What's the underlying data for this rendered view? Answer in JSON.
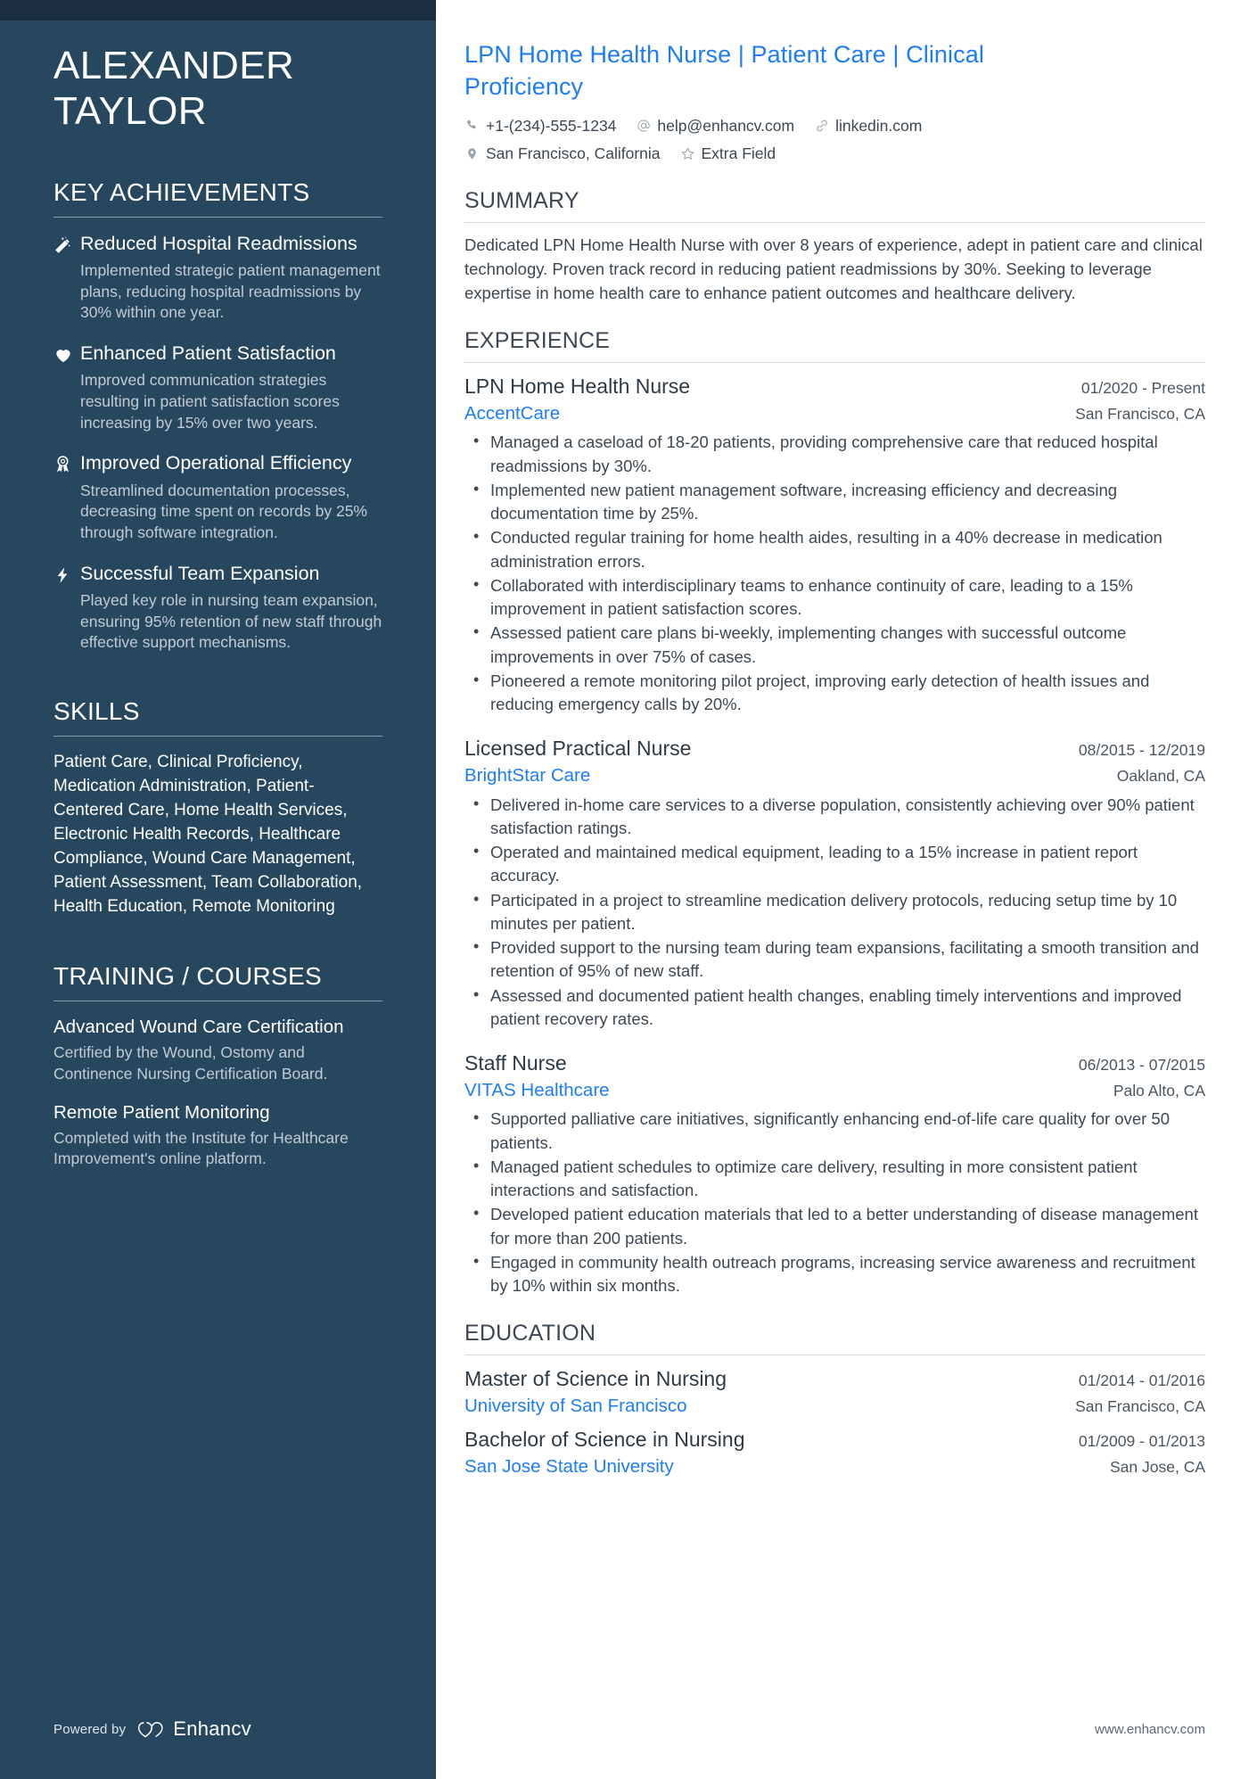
{
  "sidebar": {
    "name_first": "ALEXANDER",
    "name_last": "TAYLOR",
    "achievements_heading": "KEY ACHIEVEMENTS",
    "achievements": [
      {
        "icon": "magic-wand-icon",
        "title": "Reduced Hospital Readmissions",
        "desc": "Implemented strategic patient management plans, reducing hospital readmissions by 30% within one year."
      },
      {
        "icon": "heart-icon",
        "title": "Enhanced Patient Satisfaction",
        "desc": "Improved communication strategies resulting in patient satisfaction scores increasing by 15% over two years."
      },
      {
        "icon": "award-ribbon-icon",
        "title": "Improved Operational Efficiency",
        "desc": "Streamlined documentation processes, decreasing time spent on records by 25% through software integration."
      },
      {
        "icon": "lightning-bolt-icon",
        "title": "Successful Team Expansion",
        "desc": "Played key role in nursing team expansion, ensuring 95% retention of new staff through effective support mechanisms."
      }
    ],
    "skills_heading": "SKILLS",
    "skills_text": "Patient Care, Clinical Proficiency, Medication Administration, Patient-Centered Care, Home Health Services, Electronic Health Records, Healthcare Compliance, Wound Care Management, Patient Assessment, Team Collaboration, Health Education, Remote Monitoring",
    "training_heading": "TRAINING / COURSES",
    "courses": [
      {
        "title": "Advanced Wound Care Certification",
        "desc": "Certified by the Wound, Ostomy and Continence Nursing Certification Board."
      },
      {
        "title": "Remote Patient Monitoring",
        "desc": "Completed with the Institute for Healthcare Improvement's online platform."
      }
    ],
    "footer": {
      "powered_by": "Powered by",
      "brand": "Enhancv"
    }
  },
  "main": {
    "headline": "LPN Home Health Nurse | Patient Care | Clinical Proficiency",
    "contacts": [
      {
        "icon": "phone-icon",
        "text": "+1-(234)-555-1234"
      },
      {
        "icon": "at-email-icon",
        "text": "help@enhancv.com"
      },
      {
        "icon": "link-icon",
        "text": "linkedin.com"
      },
      {
        "icon": "location-pin-icon",
        "text": "San Francisco, California"
      },
      {
        "icon": "star-icon",
        "text": "Extra Field"
      }
    ],
    "summary_heading": "SUMMARY",
    "summary_text": "Dedicated LPN Home Health Nurse with over 8 years of experience, adept in patient care and clinical technology. Proven track record in reducing patient readmissions by 30%. Seeking to leverage expertise in home health care to enhance patient outcomes and healthcare delivery.",
    "experience_heading": "EXPERIENCE",
    "experience": [
      {
        "title": "LPN Home Health Nurse",
        "dates": "01/2020 - Present",
        "org": "AccentCare",
        "location": "San Francisco, CA",
        "bullets": [
          "Managed a caseload of 18-20 patients, providing comprehensive care that reduced hospital readmissions by 30%.",
          "Implemented new patient management software, increasing efficiency and decreasing documentation time by 25%.",
          "Conducted regular training for home health aides, resulting in a 40% decrease in medication administration errors.",
          "Collaborated with interdisciplinary teams to enhance continuity of care, leading to a 15% improvement in patient satisfaction scores.",
          "Assessed patient care plans bi-weekly, implementing changes with successful outcome improvements in over 75% of cases.",
          "Pioneered a remote monitoring pilot project, improving early detection of health issues and reducing emergency calls by 20%."
        ]
      },
      {
        "title": "Licensed Practical Nurse",
        "dates": "08/2015 - 12/2019",
        "org": "BrightStar Care",
        "location": "Oakland, CA",
        "bullets": [
          "Delivered in-home care services to a diverse population, consistently achieving over 90% patient satisfaction ratings.",
          "Operated and maintained medical equipment, leading to a 15% increase in patient report accuracy.",
          "Participated in a project to streamline medication delivery protocols, reducing setup time by 10 minutes per patient.",
          "Provided support to the nursing team during team expansions, facilitating a smooth transition and retention of 95% of new staff.",
          "Assessed and documented patient health changes, enabling timely interventions and improved patient recovery rates."
        ]
      },
      {
        "title": "Staff Nurse",
        "dates": "06/2013 - 07/2015",
        "org": "VITAS Healthcare",
        "location": "Palo Alto, CA",
        "bullets": [
          "Supported palliative care initiatives, significantly enhancing end-of-life care quality for over 50 patients.",
          "Managed patient schedules to optimize care delivery, resulting in more consistent patient interactions and satisfaction.",
          "Developed patient education materials that led to a better understanding of disease management for more than 200 patients.",
          "Engaged in community health outreach programs, increasing service awareness and recruitment by 10% within six months."
        ]
      }
    ],
    "education_heading": "EDUCATION",
    "education": [
      {
        "degree": "Master of Science in Nursing",
        "dates": "01/2014 - 01/2016",
        "school": "University of San Francisco",
        "location": "San Francisco, CA"
      },
      {
        "degree": "Bachelor of Science in Nursing",
        "dates": "01/2009 - 01/2013",
        "school": "San Jose State University",
        "location": "San Jose, CA"
      }
    ],
    "footer_url": "www.enhancv.com"
  },
  "colors": {
    "sidebar_bg": "#27475f",
    "sidebar_topbar": "#1b2f41",
    "accent_blue": "#1d7df7",
    "body_text": "#3d4852"
  }
}
